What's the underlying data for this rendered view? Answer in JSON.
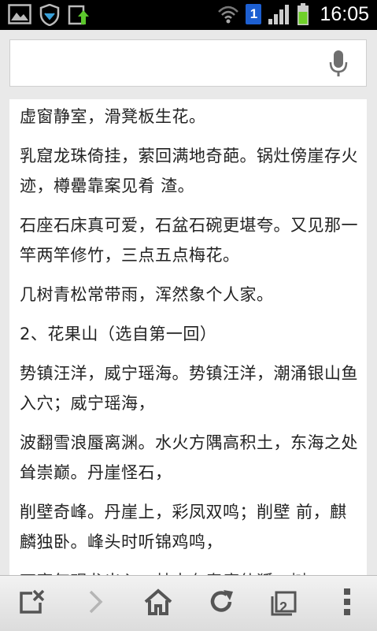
{
  "status_bar": {
    "time": "16:05",
    "notification_count": "1",
    "icons": [
      "image-icon",
      "shield-icon",
      "upload-icon",
      "wifi-icon",
      "signal-icon",
      "battery-icon"
    ]
  },
  "search": {
    "value": "",
    "placeholder": ""
  },
  "article": {
    "paragraphs": [
      "虚窗静室，滑凳板生花。",
      "乳窟龙珠倚挂，萦回满地奇葩。锅灶傍崖存火迹，樽罍靠案见肴 渣。",
      "石座石床真可爱，石盆石碗更堪夸。又见那一竿两竿修竹，三点五点梅花。",
      "几树青松常带雨，浑然象个人家。",
      "2、花果山（选自第一回）",
      "势镇汪洋，威宁瑶海。势镇汪洋，潮涌银山鱼入穴；威宁瑶海，",
      "波翻雪浪蜃离渊。水火方隅高积土，东海之处耸崇巅。丹崖怪石，",
      "削壁奇峰。丹崖上，彩凤双鸣；削壁 前，麒麟独卧。峰头时听锦鸡鸣，",
      "石窟每观龙出入。林中有寿鹿仙狐，树"
    ]
  },
  "toolbar": {
    "tab_count": "2",
    "buttons": [
      "close-tab-icon",
      "forward-icon",
      "home-icon",
      "refresh-icon",
      "tabs-icon",
      "menu-icon"
    ]
  },
  "colors": {
    "status_bar_bg": "#000000",
    "notification_badge": "#1d5fd1",
    "battery_green": "#6fd12a",
    "page_bg": "#e9e9e9"
  }
}
